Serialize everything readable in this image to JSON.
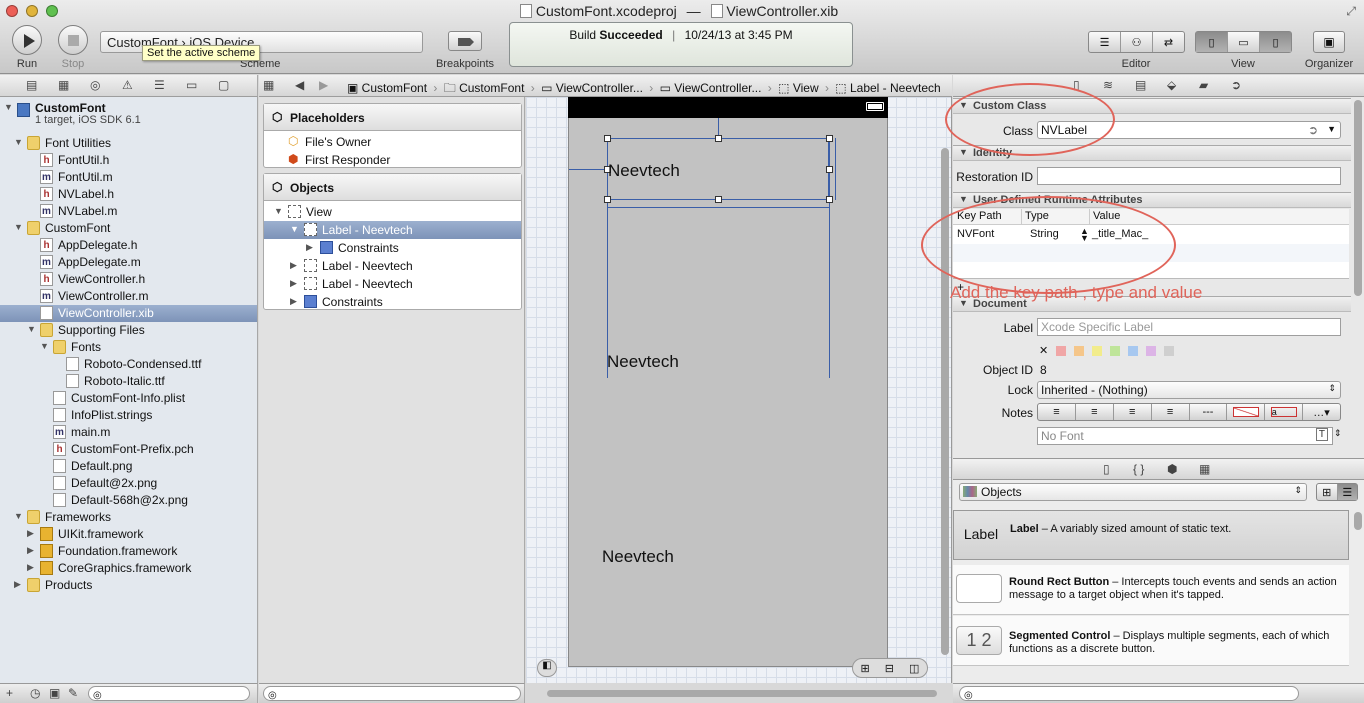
{
  "window": {
    "project_title": "CustomFont.xcodeproj",
    "separator": "—",
    "file_title": "ViewController.xib"
  },
  "toolbar": {
    "run_label": "Run",
    "stop_label": "Stop",
    "scheme_text": "CustomFont › iOS Device",
    "scheme_label": "Scheme",
    "tooltip": "Set the active scheme",
    "breakpoints_label": "Breakpoints",
    "status_prefix": "Build ",
    "status_bold": "Succeeded",
    "status_divider": "|",
    "status_time": "10/24/13 at 3:45 PM",
    "editor_label": "Editor",
    "view_label": "View",
    "organizer_label": "Organizer"
  },
  "breadcrumb": [
    "CustomFont",
    "CustomFont",
    "ViewController...",
    "ViewController...",
    "View",
    "Label - Neevtech"
  ],
  "navigator": {
    "items": [
      {
        "label": "CustomFont",
        "sub": "1 target, iOS SDK 6.1",
        "icon": "project-icon",
        "level": 0
      },
      {
        "label": "Font Utilities",
        "icon": "folder-icon",
        "level": 1
      },
      {
        "label": "FontUtil.h",
        "icon": "header-file-icon",
        "level": 2
      },
      {
        "label": "FontUtil.m",
        "icon": "impl-file-icon",
        "level": 2
      },
      {
        "label": "NVLabel.h",
        "icon": "header-file-icon",
        "level": 2
      },
      {
        "label": "NVLabel.m",
        "icon": "impl-file-icon",
        "level": 2
      },
      {
        "label": "CustomFont",
        "icon": "folder-icon",
        "level": 1
      },
      {
        "label": "AppDelegate.h",
        "icon": "header-file-icon",
        "level": 2
      },
      {
        "label": "AppDelegate.m",
        "icon": "impl-file-icon",
        "level": 2
      },
      {
        "label": "ViewController.h",
        "icon": "header-file-icon",
        "level": 2
      },
      {
        "label": "ViewController.m",
        "icon": "impl-file-icon",
        "level": 2
      },
      {
        "label": "ViewController.xib",
        "icon": "xib-file-icon",
        "level": 2,
        "selected": true
      },
      {
        "label": "Supporting Files",
        "icon": "folder-icon",
        "level": 2
      },
      {
        "label": "Fonts",
        "icon": "folder-icon",
        "level": 3
      },
      {
        "label": "Roboto-Condensed.ttf",
        "icon": "generic-file-icon",
        "level": 4
      },
      {
        "label": "Roboto-Italic.ttf",
        "icon": "generic-file-icon",
        "level": 4
      },
      {
        "label": "CustomFont-Info.plist",
        "icon": "generic-file-icon",
        "level": 3
      },
      {
        "label": "InfoPlist.strings",
        "icon": "generic-file-icon",
        "level": 3
      },
      {
        "label": "main.m",
        "icon": "impl-file-icon",
        "level": 3
      },
      {
        "label": "CustomFont-Prefix.pch",
        "icon": "header-file-icon",
        "level": 3
      },
      {
        "label": "Default.png",
        "icon": "generic-file-icon",
        "level": 3
      },
      {
        "label": "Default@2x.png",
        "icon": "generic-file-icon",
        "level": 3
      },
      {
        "label": "Default-568h@2x.png",
        "icon": "generic-file-icon",
        "level": 3
      },
      {
        "label": "Frameworks",
        "icon": "folder-icon",
        "level": 1
      },
      {
        "label": "UIKit.framework",
        "icon": "framework-icon",
        "level": 2
      },
      {
        "label": "Foundation.framework",
        "icon": "framework-icon",
        "level": 2
      },
      {
        "label": "CoreGraphics.framework",
        "icon": "framework-icon",
        "level": 2
      },
      {
        "label": "Products",
        "icon": "folder-icon",
        "level": 1
      }
    ]
  },
  "outline": {
    "placeholders_title": "Placeholders",
    "placeholders": [
      "File's Owner",
      "First Responder"
    ],
    "objects_title": "Objects",
    "objects": [
      {
        "label": "View",
        "level": 0
      },
      {
        "label": "Label - Neevtech",
        "level": 1,
        "selected": true
      },
      {
        "label": "Constraints",
        "level": 2
      },
      {
        "label": "Label - Neevtech",
        "level": 1
      },
      {
        "label": "Label - Neevtech",
        "level": 1
      },
      {
        "label": "Constraints",
        "level": 1
      }
    ]
  },
  "canvas": {
    "labels": [
      "Neevtech",
      "Neevtech",
      "Neevtech"
    ]
  },
  "inspector": {
    "custom_class_title": "Custom Class",
    "class_label": "Class",
    "class_value": "NVLabel",
    "identity_title": "Identity",
    "restoration_label": "Restoration ID",
    "restoration_value": "",
    "runtime_title": "User Defined Runtime Attributes",
    "col_keypath": "Key Path",
    "col_type": "Type",
    "col_value": "Value",
    "row_keypath": "NVFont",
    "row_type": "String",
    "row_value": "_title_Mac_",
    "document_title": "Document",
    "doc_label_label": "Label",
    "doc_label_placeholder": "Xcode Specific Label",
    "object_id_label": "Object ID",
    "object_id_value": "8",
    "lock_label": "Lock",
    "lock_value": "Inherited - (Nothing)",
    "notes_label": "Notes",
    "font_placeholder": "No Font"
  },
  "annotation_text": "Add the key path , type and value",
  "library": {
    "selector": "Objects",
    "items": [
      {
        "icon_text": "Label",
        "title": "Label",
        "desc": " – A variably sized amount of static text."
      },
      {
        "icon_text": "",
        "title": "Round Rect Button",
        "desc": " – Intercepts touch events and sends an action message to a target object when it's tapped."
      },
      {
        "icon_text": "1 2",
        "title": "Segmented Control",
        "desc": " – Displays multiple segments, each of which functions as a discrete button."
      }
    ]
  },
  "colors": {
    "annotation": "#e0645a",
    "selection": "#8ea2c4",
    "navigator_bg": "#e3e8ee"
  }
}
